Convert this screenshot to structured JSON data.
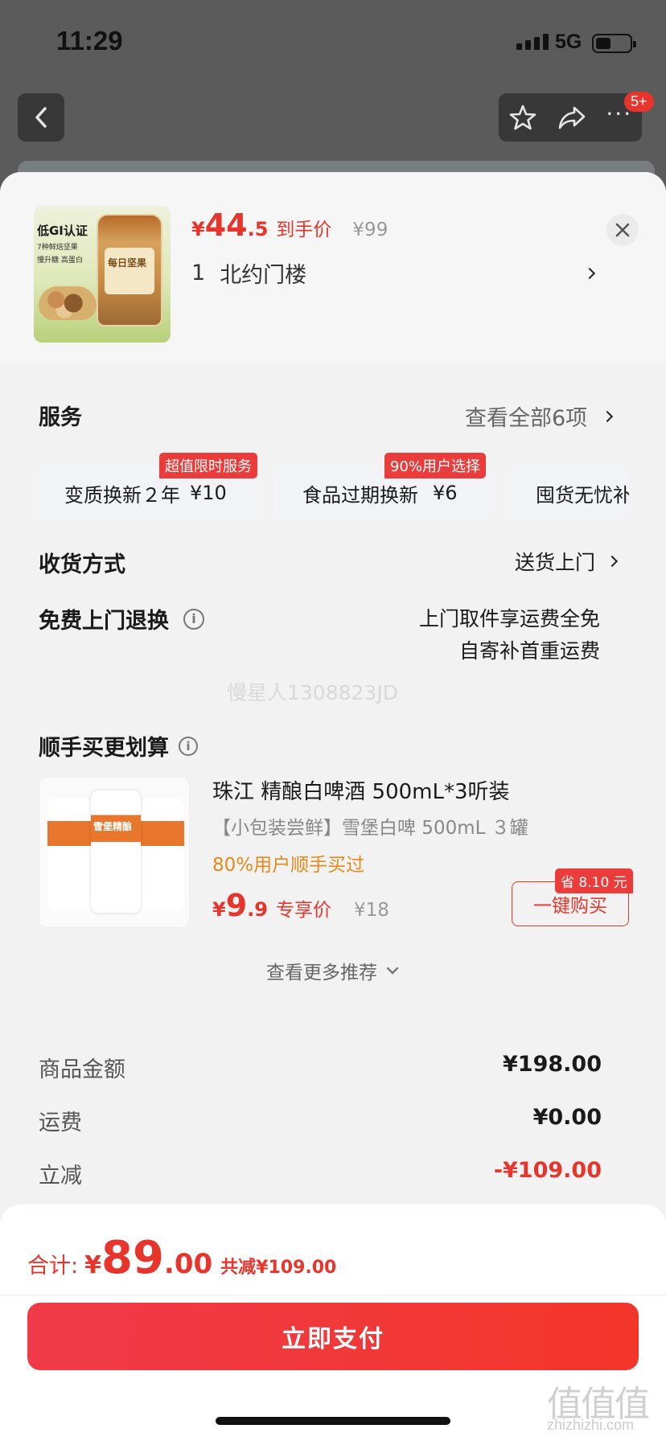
{
  "status": {
    "time": "11:29",
    "network": "5G"
  },
  "nav": {
    "cart_badge": "5+"
  },
  "product": {
    "img_text_1": "低GI认证",
    "img_text_2": "7种鲜焙坚果",
    "img_text_3": "慢升糖 高蛋白",
    "img_brand": "每日坚果",
    "price_symbol": "¥",
    "price_int": "44",
    "price_dec": ".5",
    "price_label": "到手价",
    "original_price": "¥99",
    "quantity": "1",
    "location": "北约门楼"
  },
  "service": {
    "title": "服务",
    "view_all": "查看全部6项",
    "items": [
      {
        "name": "变质换新２年",
        "price": "¥10",
        "tag": "超值限时服务"
      },
      {
        "name": "食品过期换新",
        "price": "¥6",
        "tag": "90%用户选择"
      },
      {
        "name": "囤货无忧补",
        "price": "",
        "tag": ""
      }
    ]
  },
  "delivery": {
    "title": "收货方式",
    "value": "送货上门"
  },
  "returns": {
    "title": "免费上门退换",
    "line1": "上门取件享运费全免",
    "line2": "自寄补首重运费"
  },
  "watermark": "慢星人1308823JD",
  "recommend": {
    "title": "顺手买更划算",
    "item_name": "珠江 精酿白啤酒 500mL*3听装",
    "item_sub": "【小包装尝鲜】雪堡白啤 500mL ３罐",
    "item_stat": "80%用户顺手买过",
    "price_symbol": "¥",
    "price_int": "9",
    "price_dec": ".9",
    "price_label": "专享价",
    "original_price": "¥18",
    "save_tag": "省 8.10 元",
    "buy_button": "一键购买",
    "can_label": "雪堡精酿",
    "more": "查看更多推荐"
  },
  "summary": {
    "rows": [
      {
        "label": "商品金额",
        "value": "¥198.00"
      },
      {
        "label": "运费",
        "value": "¥0.00"
      },
      {
        "label": "立减",
        "value": "-¥109.00"
      }
    ]
  },
  "footer": {
    "total_label": "合计:",
    "total_symbol": "¥",
    "total_int": "89",
    "total_dec": ".00",
    "saved": "共减¥109.00",
    "pay_button": "立即支付"
  },
  "site_watermark": {
    "logo": "值值值",
    "url": "zhizhizhi.com"
  }
}
